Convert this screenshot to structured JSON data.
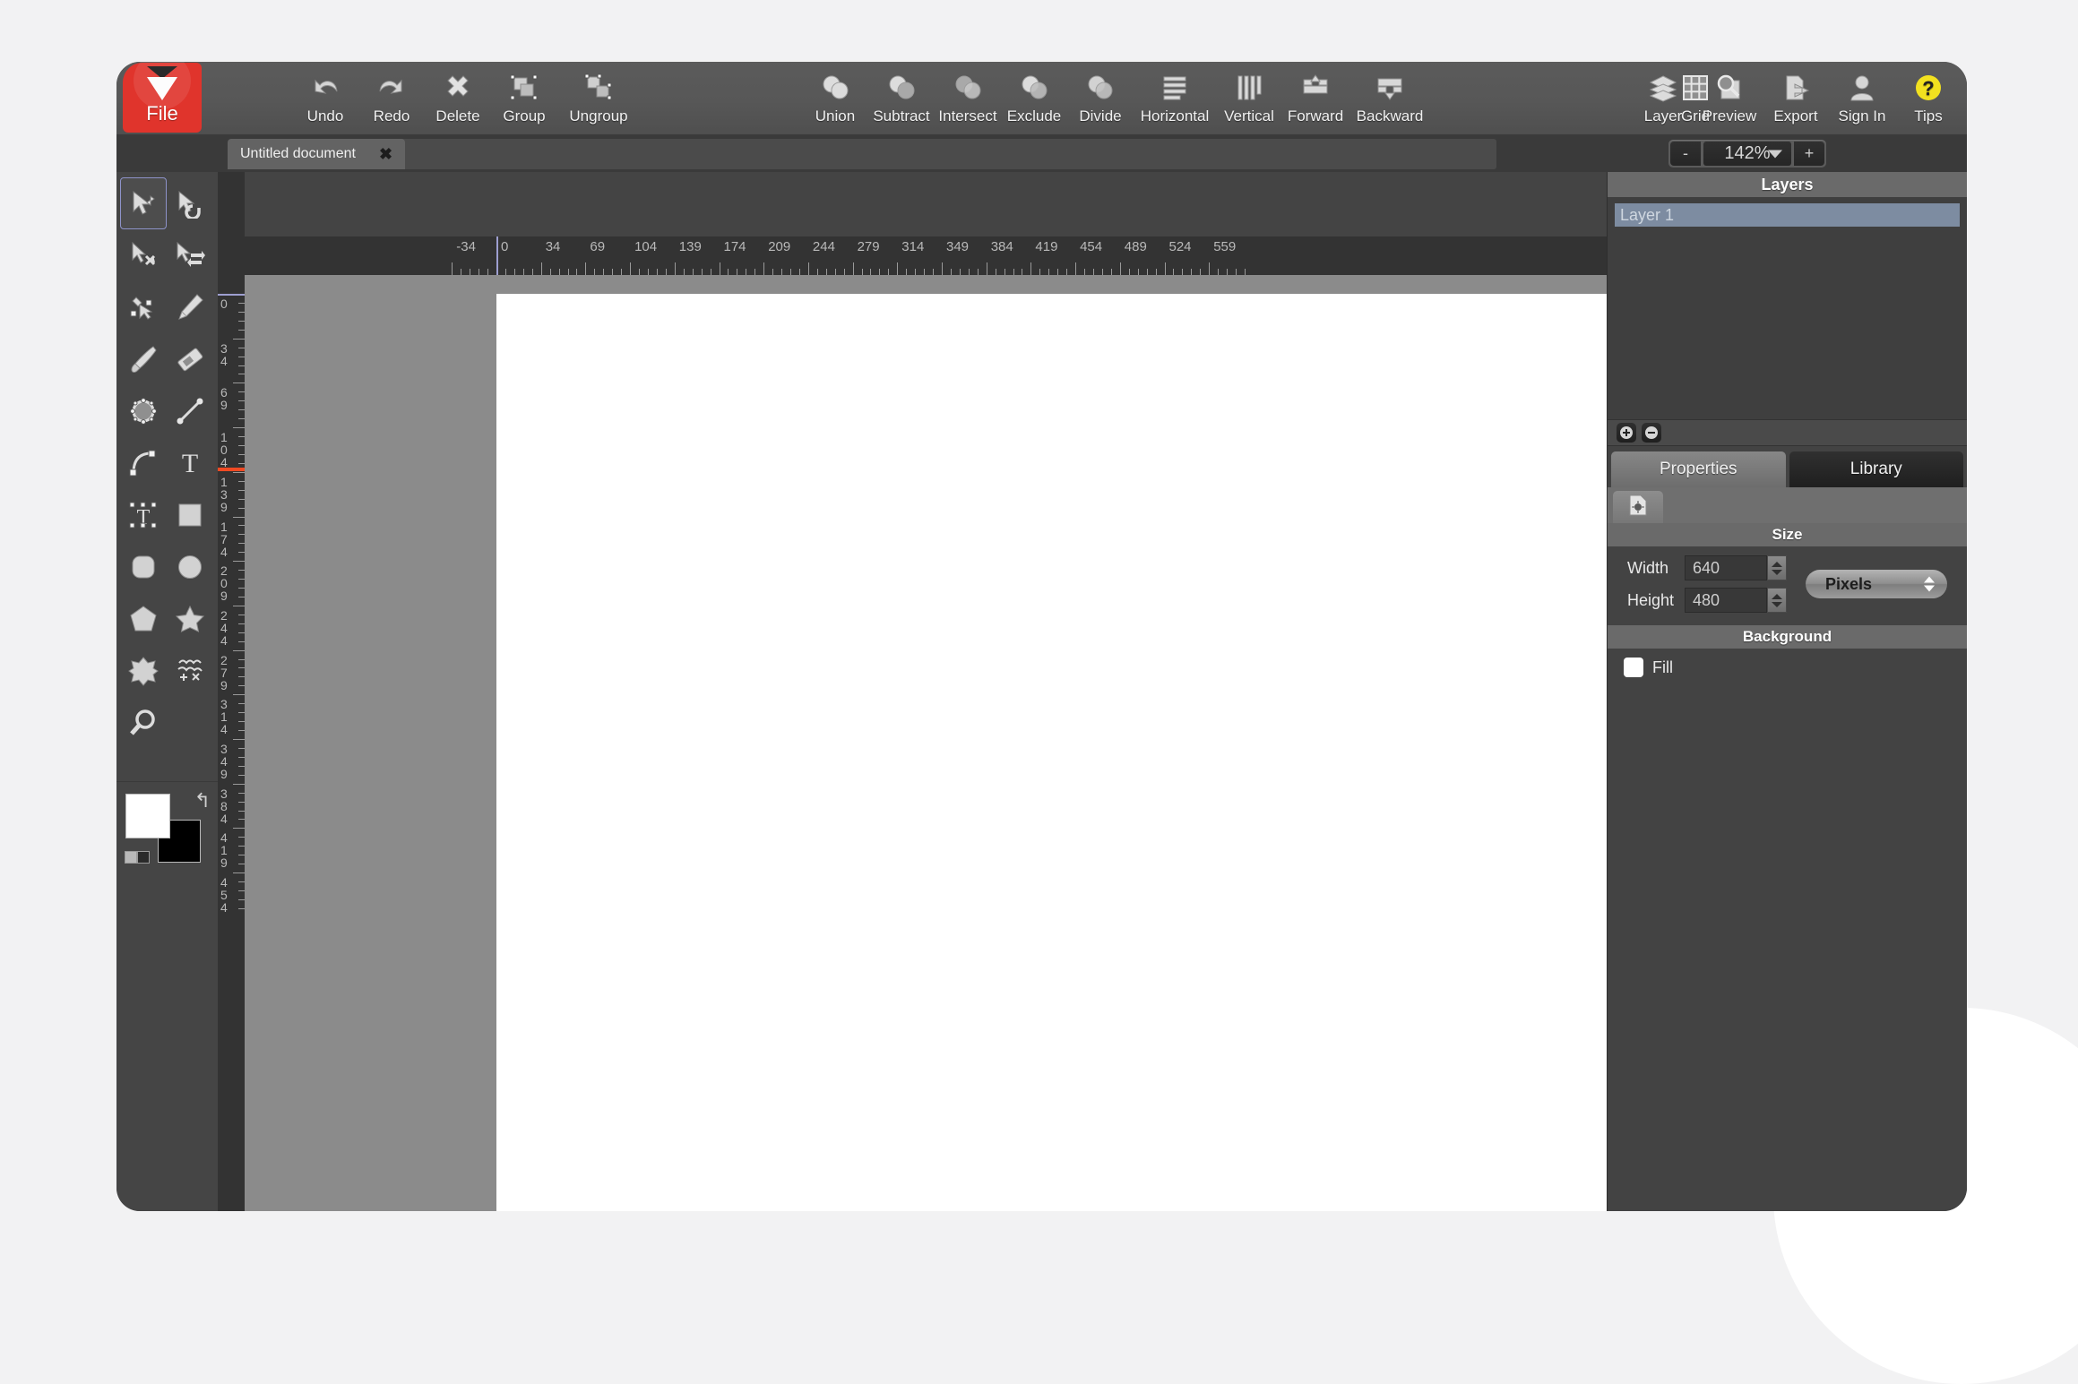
{
  "window": {
    "title": "Untitled document"
  },
  "toolbar": {
    "file_label": "File",
    "groups": [
      {
        "name": "history",
        "items": [
          {
            "label": "Undo",
            "icon": "undo-arrow-icon"
          },
          {
            "label": "Redo",
            "icon": "redo-arrow-icon"
          },
          {
            "label": "Delete",
            "icon": "x-cross-icon"
          },
          {
            "label": "Group",
            "icon": "group-shapes-icon"
          },
          {
            "label": "Ungroup",
            "icon": "ungroup-shapes-icon"
          }
        ]
      },
      {
        "name": "pathops",
        "items": [
          {
            "label": "Union",
            "icon": "union-icon"
          },
          {
            "label": "Subtract",
            "icon": "subtract-icon"
          },
          {
            "label": "Intersect",
            "icon": "intersect-icon"
          },
          {
            "label": "Exclude",
            "icon": "exclude-icon"
          },
          {
            "label": "Divide",
            "icon": "divide-icon"
          },
          {
            "label": "Horizontal",
            "icon": "flip-horizontal-icon"
          },
          {
            "label": "Vertical",
            "icon": "flip-vertical-icon"
          },
          {
            "label": "Forward",
            "icon": "bring-forward-icon"
          },
          {
            "label": "Backward",
            "icon": "send-backward-icon"
          }
        ]
      },
      {
        "name": "view",
        "items": [
          {
            "label": "Grid",
            "icon": "grid-icon"
          }
        ]
      },
      {
        "name": "account",
        "items": [
          {
            "label": "Layer",
            "icon": "layers-stack-icon"
          },
          {
            "label": "Preview",
            "icon": "magnifier-page-icon"
          },
          {
            "label": "Export",
            "icon": "export-page-icon"
          },
          {
            "label": "Sign In",
            "icon": "user-person-icon"
          },
          {
            "label": "Tips",
            "icon": "question-mark-icon"
          }
        ]
      }
    ]
  },
  "tabstrip": {
    "document_tab": "Untitled document",
    "close_glyph": "✖",
    "zoom": {
      "minus": "-",
      "value": "142%",
      "plus": "+"
    }
  },
  "tools": [
    {
      "name": "select-move-tool",
      "icon": "cursor-move-icon",
      "selected": true
    },
    {
      "name": "rotate-tool",
      "icon": "cursor-rotate-icon",
      "selected": false
    },
    {
      "name": "scale-tool",
      "icon": "cursor-scale-icon",
      "selected": false
    },
    {
      "name": "flip-tool",
      "icon": "cursor-flip-icon",
      "selected": false
    },
    {
      "name": "node-edit-tool",
      "icon": "node-edit-icon",
      "selected": false
    },
    {
      "name": "pencil-tool",
      "icon": "pencil-icon",
      "selected": false
    },
    {
      "name": "brush-tool",
      "icon": "paintbrush-icon",
      "selected": false
    },
    {
      "name": "eraser-tool",
      "icon": "eraser-icon",
      "selected": false
    },
    {
      "name": "knot-tool",
      "icon": "knot-circle-icon",
      "selected": false
    },
    {
      "name": "line-tool",
      "icon": "line-segment-icon",
      "selected": false
    },
    {
      "name": "curve-tool",
      "icon": "bezier-curve-icon",
      "selected": false
    },
    {
      "name": "text-tool",
      "icon": "text-t-icon",
      "selected": false
    },
    {
      "name": "text-box-tool",
      "icon": "text-box-icon",
      "selected": false
    },
    {
      "name": "rectangle-tool",
      "icon": "square-icon",
      "selected": false
    },
    {
      "name": "rounded-rectangle-tool",
      "icon": "rounded-square-icon",
      "selected": false
    },
    {
      "name": "ellipse-tool",
      "icon": "circle-icon",
      "selected": false
    },
    {
      "name": "polygon-tool",
      "icon": "pentagon-icon",
      "selected": false
    },
    {
      "name": "star-tool",
      "icon": "star-icon",
      "selected": false
    },
    {
      "name": "gear-shape-tool",
      "icon": "gear-shape-icon",
      "selected": false
    },
    {
      "name": "symbols-tool",
      "icon": "symbols-icon",
      "selected": false
    },
    {
      "name": "zoom-tool",
      "icon": "magnifier-icon",
      "selected": false
    }
  ],
  "color_swatches": {
    "fill": "#ffffff",
    "stroke": "#000000",
    "swap_glyph": "↰"
  },
  "rulers": {
    "horizontal_labels": [
      "-34",
      "0",
      "34",
      "69",
      "104",
      "139",
      "174",
      "209",
      "244",
      "279",
      "314",
      "349",
      "384",
      "419",
      "454",
      "489",
      "524",
      "559"
    ],
    "vertical_labels": [
      "0",
      "34",
      "69",
      "104",
      "139",
      "174",
      "209",
      "244",
      "279",
      "314",
      "349",
      "384",
      "419",
      "454"
    ],
    "origin_color": "#9e9fd0",
    "edge_marker_color": "#f04a23"
  },
  "right_panel": {
    "layers_title": "Layers",
    "layers": [
      {
        "name": "Layer 1"
      }
    ],
    "layer_buttons": [
      {
        "name": "add-layer-button",
        "glyph": "+"
      },
      {
        "name": "remove-layer-button",
        "glyph": "−"
      }
    ],
    "tabs": [
      {
        "label": "Properties",
        "active": true
      },
      {
        "label": "Library",
        "active": false
      }
    ],
    "subtab_icon": "document-settings-icon",
    "size_section": {
      "title": "Size",
      "width_label": "Width",
      "width_value": "640",
      "height_label": "Height",
      "height_value": "480",
      "unit_value": "Pixels"
    },
    "background_section": {
      "title": "Background",
      "fill_label": "Fill",
      "fill_checked": false
    }
  },
  "canvas": {
    "artboard_color": "#ffffff",
    "workspace_color": "#8b8b8b"
  }
}
